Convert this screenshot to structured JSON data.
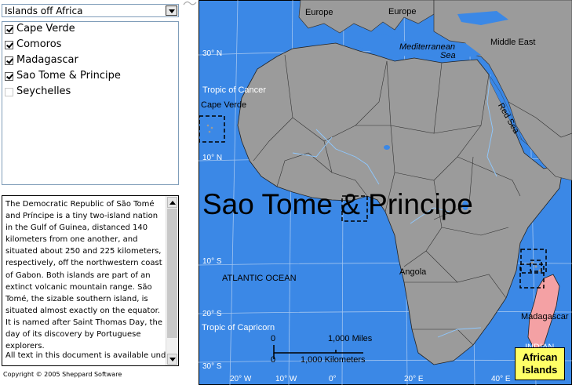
{
  "selector": {
    "value": "Islands off Africa"
  },
  "islands": [
    {
      "label": "Cape Verde",
      "checked": true
    },
    {
      "label": "Comoros",
      "checked": true
    },
    {
      "label": "Madagascar",
      "checked": true
    },
    {
      "label": "Sao Tome & Principe",
      "checked": true
    },
    {
      "label": "Seychelles",
      "checked": false
    }
  ],
  "description": {
    "text": "The Democratic Republic of São Tomé and Príncipe is a tiny two-island nation in the Gulf of Guinea, distanced 140 kilometers from one another, and situated about 250 and 225 kilometers, respectively, off the northwestern coast of Gabon. Both islands are part of an extinct volcanic mountain range. São Tomé, the sizable southern island, is situated almost exactly on the equator. It is named after Saint Thomas Day, the day of its discovery by Portuguese explorers.",
    "more": "All text in this document is available under"
  },
  "copyright": "Copyright © 2005 Sheppard Software",
  "map": {
    "overlay_label": "Sao Tome & Principe",
    "badge_line1": "African",
    "badge_line2": "Islands",
    "labels": {
      "europe1": "Europe",
      "europe2": "Europe",
      "middle_east": "Middle East",
      "med_sea_1": "Mediterranean",
      "med_sea_2": "Sea",
      "tropic_cancer": "Tropic of Cancer",
      "cape_verde": "Cape Verde",
      "red_sea": "Red Sea",
      "atlantic": "ATLANTIC OCEAN",
      "angola": "Angola",
      "madagascar": "Madagascar",
      "tropic_capricorn": "Tropic of Capricorn",
      "indian": "INDIAN"
    },
    "latitudes": {
      "n30": "30° N",
      "n10": "10° N",
      "s10": "10° S",
      "s20": "20° S",
      "s30": "30° S"
    },
    "longitudes": {
      "w20": "20° W",
      "w10": "10° W",
      "e0": "0°",
      "e20": "20° E",
      "e40": "40° E"
    },
    "scale": {
      "zero1": "0",
      "miles": "1,000 Miles",
      "zero2": "0",
      "km": "1,000 Kilometers"
    }
  }
}
